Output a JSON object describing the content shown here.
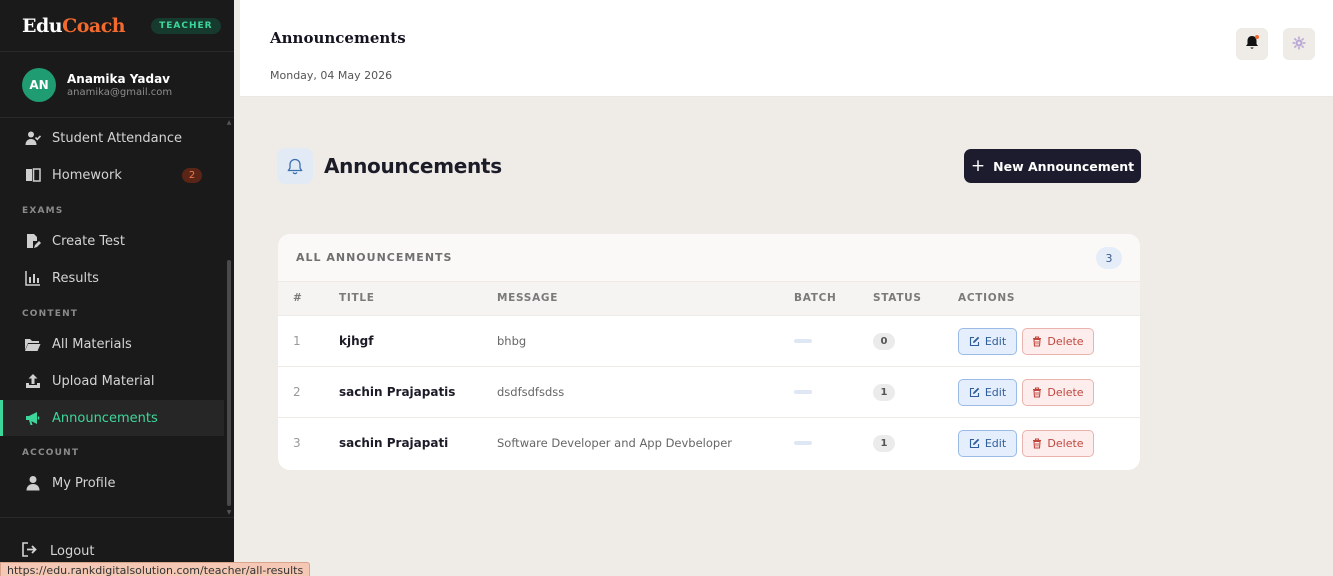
{
  "sidebar": {
    "brand": {
      "part1": "Edu",
      "part2": "Coach"
    },
    "role": "TEACHER",
    "user": {
      "initials": "AN",
      "name": "Anamika Yadav",
      "email": "anamika@gmail.com"
    },
    "items": [
      {
        "label": "Student Attendance",
        "icon": "user-check-icon"
      },
      {
        "label": "Homework",
        "icon": "book-icon",
        "count": "2"
      },
      {
        "label": "Create Test",
        "icon": "file-edit-icon"
      },
      {
        "label": "Results",
        "icon": "bar-chart-icon"
      },
      {
        "label": "All Materials",
        "icon": "folder-icon"
      },
      {
        "label": "Upload Material",
        "icon": "upload-icon"
      },
      {
        "label": "Announcements",
        "icon": "megaphone-icon",
        "active": true
      },
      {
        "label": "My Profile",
        "icon": "user-icon"
      }
    ],
    "sections": {
      "exams": "EXAMS",
      "content": "CONTENT",
      "account": "ACCOUNT"
    },
    "logout": "Logout"
  },
  "statusbar": {
    "url": "https://edu.rankdigitalsolution.com/teacher/all-results"
  },
  "header": {
    "title": "Announcements",
    "date": "Monday, 04 May 2026"
  },
  "main": {
    "title": "Announcements",
    "new_button": "New Announcement",
    "card_title": "ALL ANNOUNCEMENTS",
    "count": "3",
    "columns": [
      "#",
      "TITLE",
      "MESSAGE",
      "BATCH",
      "STATUS",
      "ACTIONS"
    ],
    "rows": [
      {
        "num": "1",
        "title": "kjhgf",
        "message": "bhbg",
        "status": "0"
      },
      {
        "num": "2",
        "title": "sachin Prajapatis",
        "message": "dsdfsdfsdss",
        "status": "1"
      },
      {
        "num": "3",
        "title": "sachin Prajapati",
        "message": "Software Developer and App Devbeloper",
        "status": "1"
      }
    ],
    "edit_label": "Edit",
    "delete_label": "Delete"
  },
  "colors": {
    "accent": "#3ed79b",
    "brand_orange": "#f26a2e",
    "sidebar_bg": "#1a1a1a",
    "primary_button": "#1c1c2e"
  }
}
